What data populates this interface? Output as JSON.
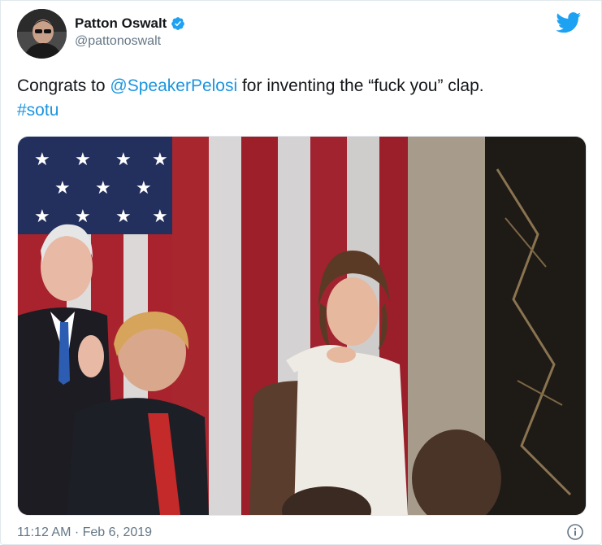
{
  "tweet": {
    "display_name": "Patton Oswalt",
    "handle": "@pattonoswalt",
    "text_before": "Congrats to ",
    "mention": "@SpeakerPelosi",
    "text_after": " for inventing the “fuck you” clap.",
    "hashtag": "#sotu",
    "timestamp": "11:12 AM · Feb 6, 2019"
  },
  "icons": {
    "verified": "verified-badge-icon",
    "brand": "twitter-bird-icon",
    "info": "info-icon"
  },
  "colors": {
    "link": "#1b95e0",
    "verified": "#1da1f2",
    "muted": "#657786",
    "text": "#14171a"
  }
}
